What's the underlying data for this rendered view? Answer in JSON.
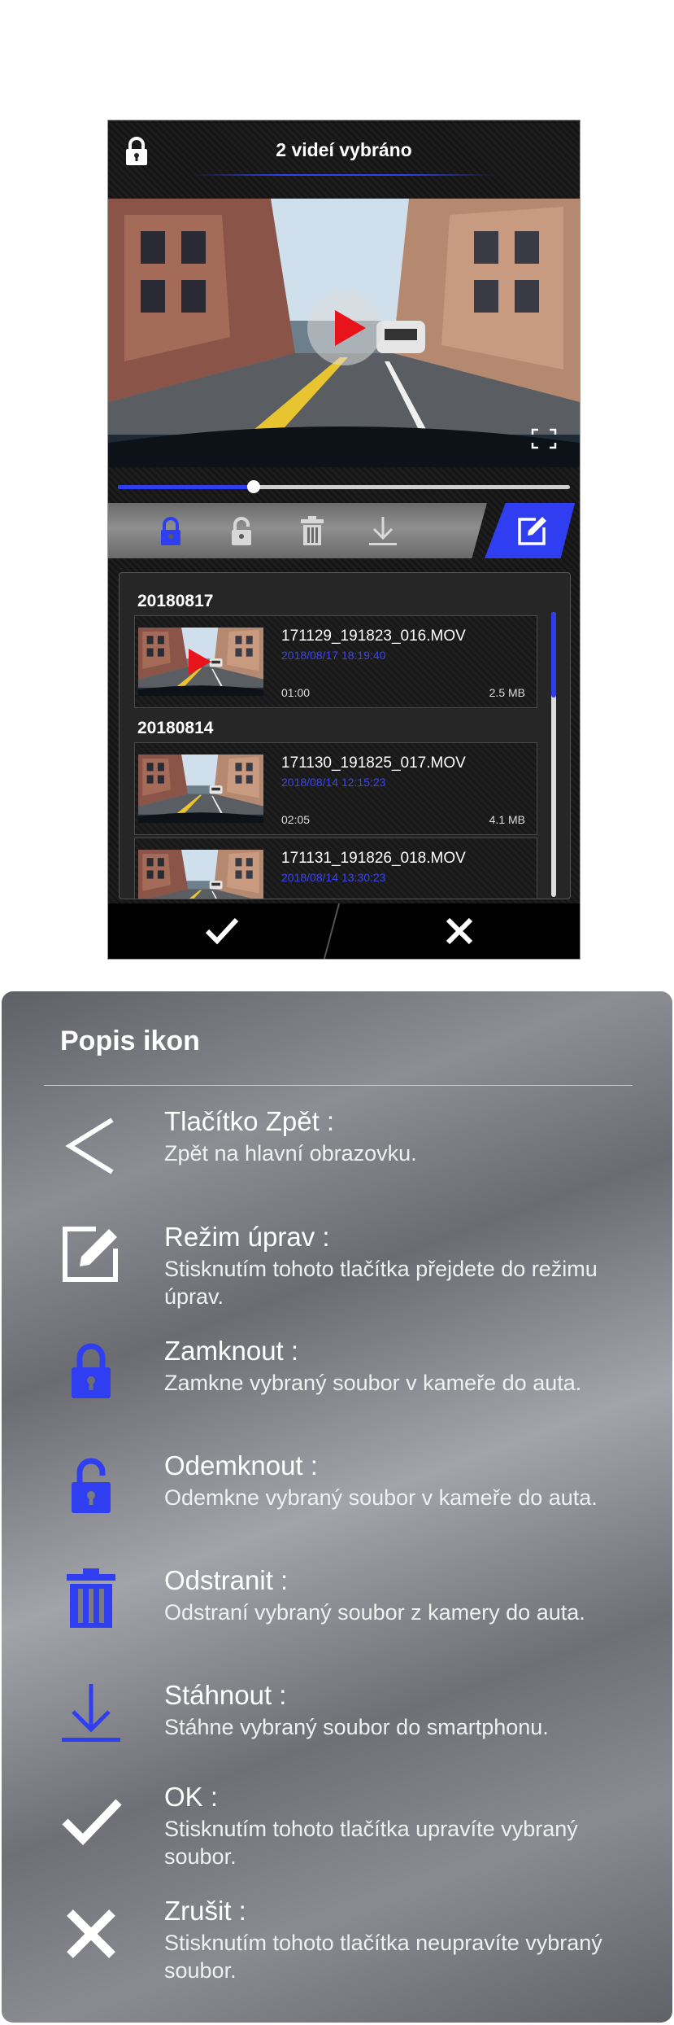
{
  "phone": {
    "title": "2 videí vybráno",
    "progress_fraction": 0.3,
    "toolbar_icons": [
      "lock-icon",
      "unlock-icon",
      "trash-icon",
      "download-icon",
      "edit-icon"
    ],
    "list": {
      "groups": [
        {
          "date": "20180817",
          "items": [
            {
              "name": "171129_191823_016.MOV",
              "datetime": "2018/08/17 18:19:40",
              "duration": "01:00",
              "size": "2.5 MB"
            }
          ]
        },
        {
          "date": "20180814",
          "items": [
            {
              "name": "171130_191825_017.MOV",
              "datetime": "2018/08/14 12:15:23",
              "duration": "02:05",
              "size": "4.1 MB"
            },
            {
              "name": "171131_191826_018.MOV",
              "datetime": "2018/08/14 13:30:23",
              "duration": "",
              "size": ""
            }
          ]
        }
      ]
    },
    "bottom": {
      "ok_icon": "check-icon",
      "cancel_icon": "close-icon"
    }
  },
  "legend": {
    "title": "Popis ikon",
    "entries": [
      {
        "icon": "back-icon",
        "name": "Tlačítko Zpět :",
        "desc": "Zpět na hlavní obrazovku."
      },
      {
        "icon": "edit-icon",
        "name": "Režim úprav :",
        "desc": "Stisknutím tohoto tlačítka přejdete do režimu úprav."
      },
      {
        "icon": "lock-icon",
        "name": "Zamknout :",
        "desc": "Zamkne vybraný soubor v kameře do auta."
      },
      {
        "icon": "unlock-icon",
        "name": "Odemknout :",
        "desc": "Odemkne vybraný soubor v kameře do auta."
      },
      {
        "icon": "trash-icon",
        "name": "Odstranit :",
        "desc": "Odstraní vybraný soubor z kamery do auta."
      },
      {
        "icon": "download-icon",
        "name": "Stáhnout :",
        "desc": "Stáhne vybraný soubor do smartphonu."
      },
      {
        "icon": "check-icon",
        "name": "OK :",
        "desc": "Stisknutím tohoto tlačítka upravíte vybraný soubor."
      },
      {
        "icon": "close-icon",
        "name": "Zrušit  :",
        "desc": "Stisknutím tohoto tlačítka neupravíte vybraný soubor."
      }
    ]
  },
  "colors": {
    "accent": "#2f3ef0",
    "play": "#e8141c"
  }
}
